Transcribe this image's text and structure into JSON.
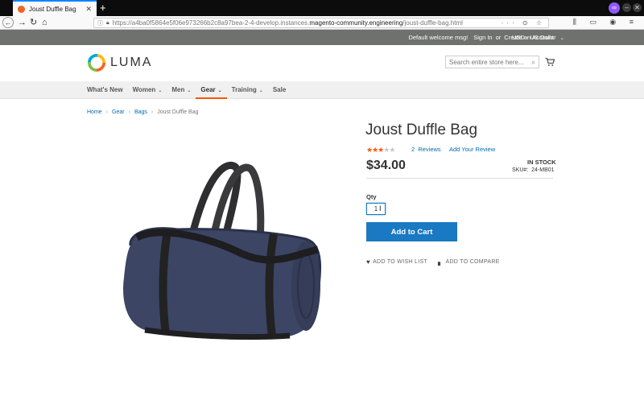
{
  "browser": {
    "tab_title": "Joust Duffle Bag",
    "new_tab": "+",
    "url_prefix": "https://a4ba0f5864e5f06e973266b2c8a97bea-2-4-develop.instances.",
    "url_domain": "magento-community.engineering",
    "url_path": "/joust-duffle-bag.html",
    "url_icons": "··· ⊙ ☆",
    "toolbar_icons": "⫼ ▭ ◉ ≡"
  },
  "panel": {
    "welcome": "Default welcome msg!",
    "sign_in": "Sign In",
    "or": "or",
    "create_account": "Create an Account",
    "currency": "USD - US Dollar"
  },
  "header": {
    "logo_text": "LUMA",
    "search_placeholder": "Search entire store here..."
  },
  "menu": {
    "items": [
      {
        "label": "What's New",
        "caret": false
      },
      {
        "label": "Women",
        "caret": true
      },
      {
        "label": "Men",
        "caret": true
      },
      {
        "label": "Gear",
        "caret": true
      },
      {
        "label": "Training",
        "caret": true
      },
      {
        "label": "Sale",
        "caret": false
      }
    ]
  },
  "breadcrumbs": [
    "Home",
    "Gear",
    "Bags",
    "Joust Duffle Bag"
  ],
  "product": {
    "name": "Joust Duffle Bag",
    "rating": 2.5,
    "rating_max": 5,
    "reviews_count": "2",
    "reviews_label": "Reviews",
    "add_review": "Add Your Review",
    "price": "$34.00",
    "stock": "IN STOCK",
    "sku_label": "SKU#:",
    "sku": "24-MB01",
    "qty_label": "Qty",
    "qty_value": "1",
    "add_to_cart": "Add to Cart",
    "wishlist": "ADD TO WISH LIST",
    "compare": "ADD TO COMPARE"
  },
  "colors": {
    "accent": "#1979c3",
    "brand_orange": "#ff5501",
    "panel_bg": "#6e716e",
    "link": "#006bb4"
  }
}
